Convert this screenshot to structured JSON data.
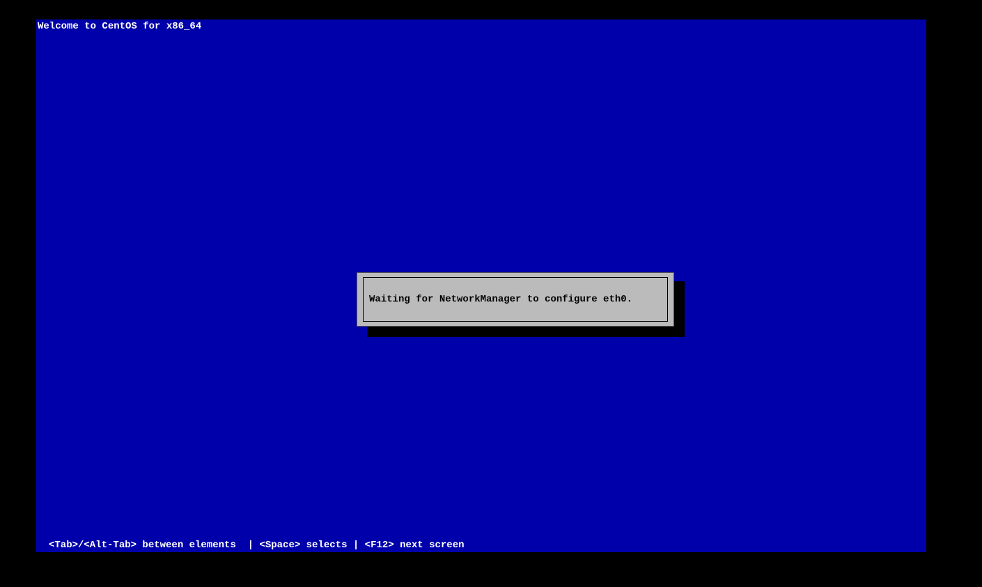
{
  "header": {
    "title": "Welcome to CentOS for x86_64"
  },
  "dialog": {
    "message": "Waiting for NetworkManager to configure eth0."
  },
  "footer": {
    "hints": "<Tab>/<Alt-Tab> between elements  | <Space> selects | <F12> next screen"
  }
}
